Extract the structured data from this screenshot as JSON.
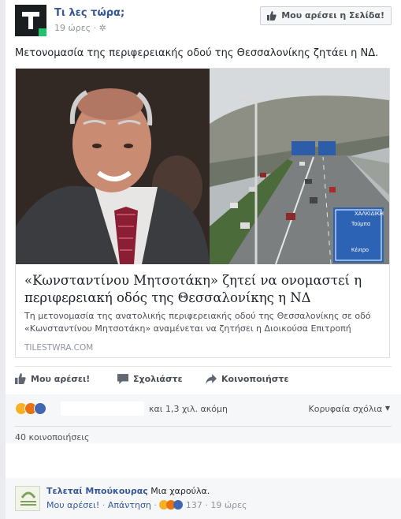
{
  "page": {
    "name": "Τι λες τώρα;",
    "time": "19 ώρες",
    "privacy_icon": "gear-icon",
    "like_button": "Μου αρέσει η Σελίδα!"
  },
  "post": {
    "message": "Μετονομασία της περιφερειακής οδού της Θεσσαλονίκης ζητάει η ΝΔ."
  },
  "card": {
    "title": "«Κωνσταντίνου Μητσοτάκη» ζητεί να ονομαστεί η περιφερειακή οδός της Θεσσαλονίκης η ΝΔ",
    "description": "Τη μετονομασία της ανατολικής περιφερειακής οδού της Θεσσαλονίκης σε οδό «Κωνσταντίνου Μητσοτάκη» αναμένεται να ζητήσει η Διοικούσα Επιτροπή Νομού…",
    "domain": "TILESTWRA.COM",
    "sign_line1": "ΧΑΛΚΙΔΙΚΗ",
    "sign_line2": "Τούμπα",
    "sign_line3": "Κέντρο"
  },
  "actions": {
    "like": "Μου αρέσει!",
    "comment": "Σχολιάστε",
    "share": "Κοινοποιήστε"
  },
  "feedback": {
    "others": "και 1,3 χιλ. ακόμη",
    "sort": "Κορυφαία σχόλια",
    "shares": "40 κοινοποιήσεις",
    "colors": {
      "like": "#4267b2",
      "haha": "#f7b125",
      "angry": "#e9710f"
    }
  },
  "comment": {
    "author": "Τελεταί Μπούκουρας",
    "text": "Μια χαρούλα.",
    "like": "Μου αρέσει!",
    "reply": "Απάντηση",
    "count": "137",
    "time": "19 ώρες"
  }
}
